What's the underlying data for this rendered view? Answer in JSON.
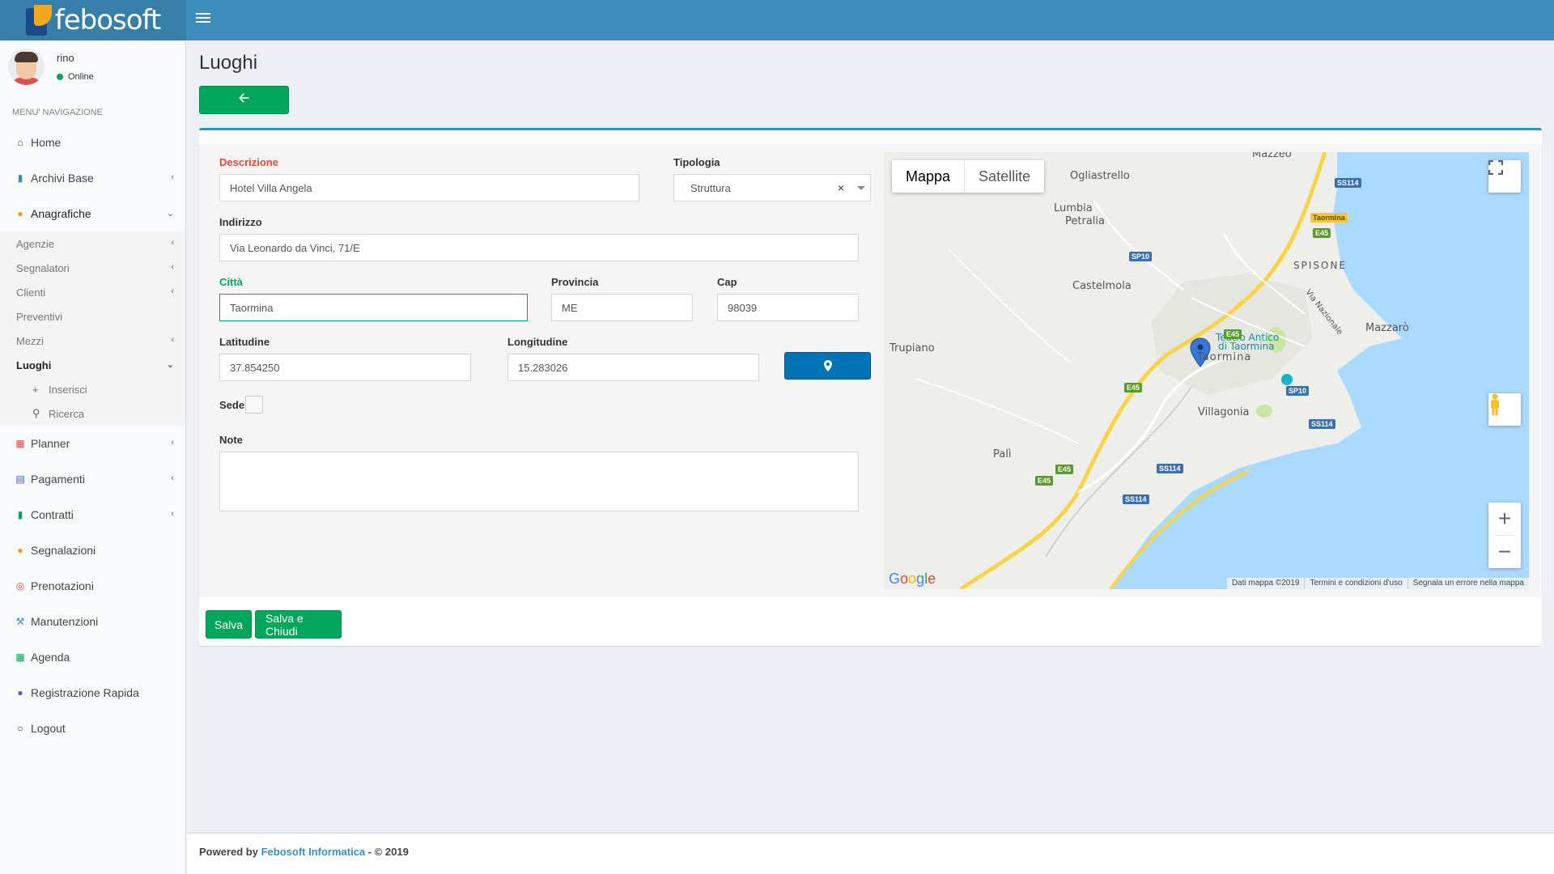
{
  "app": {
    "logo_text": "febosoft"
  },
  "user": {
    "name": "rino",
    "status": "Online"
  },
  "menu": {
    "header": "MENU' NAVIGAZIONE",
    "items": [
      {
        "label": "Home",
        "icon": "home-icon"
      },
      {
        "label": "Archivi Base",
        "icon": "book-icon"
      },
      {
        "label": "Anagrafiche",
        "icon": "user-icon"
      },
      {
        "label": "Planner",
        "icon": "calendar-icon"
      },
      {
        "label": "Pagamenti",
        "icon": "credit-card-icon"
      },
      {
        "label": "Contratti",
        "icon": "file-icon"
      },
      {
        "label": "Segnalazioni",
        "icon": "user-icon"
      },
      {
        "label": "Prenotazioni",
        "icon": "life-ring-icon"
      },
      {
        "label": "Manutenzioni",
        "icon": "wrench-icon"
      },
      {
        "label": "Agenda",
        "icon": "calendar-icon"
      },
      {
        "label": "Registrazione Rapida",
        "icon": "users-icon"
      },
      {
        "label": "Logout",
        "icon": "circle-icon"
      }
    ],
    "anagrafiche_sub": [
      "Agenzie",
      "Segnalatori",
      "Clienti",
      "Preventivi",
      "Mezzi",
      "Luoghi"
    ],
    "luoghi_sub": [
      "Inserisci",
      "Ricerca"
    ]
  },
  "page": {
    "title": "Luoghi"
  },
  "form": {
    "descrizione_label": "Descrizione",
    "descrizione_value": "Hotel Villa Angela",
    "tipologia_label": "Tipologia",
    "tipologia_value": "Struttura",
    "tipologia_clear": "×",
    "indirizzo_label": "Indirizzo",
    "indirizzo_value": "Via Leonardo da Vinci, 71/E",
    "citta_label": "Città",
    "citta_value": "Taormina",
    "provincia_label": "Provincia",
    "provincia_value": "ME",
    "cap_label": "Cap",
    "cap_value": "98039",
    "latitudine_label": "Latitudine",
    "latitudine_value": "37.854250",
    "longitudine_label": "Longitudine",
    "longitudine_value": "15.283026",
    "sede_label": "Sede",
    "note_label": "Note",
    "save_label": "Salva",
    "save_close_label": "Salva e Chiudi"
  },
  "map": {
    "type_map": "Mappa",
    "type_satellite": "Satellite",
    "places": [
      "Mazzeo",
      "Ogliastrello",
      "Lumbia",
      "Petralia",
      "SPISONE",
      "Castelmola",
      "Via Nazionale",
      "Mazzarò",
      "Teatro Antico",
      "di Taormina",
      "Taormina",
      "Trupiano",
      "Villagonia",
      "Palì"
    ],
    "roads": [
      "SS114",
      "E45",
      "SP10",
      "Taormina"
    ],
    "footer": [
      "Dati mappa ©2019",
      "Termini e condizioni d'uso",
      "Segnala un errore nella mappa"
    ],
    "google": "Google",
    "water_color": "#aadaff",
    "land_color": "#eeefea"
  },
  "footer": {
    "powered": "Powered by",
    "company": "Febosoft Informatica",
    "copyright": "- © 2019"
  },
  "colors": {
    "header": "#3c8dbc",
    "logo_bg": "#367fa9",
    "success": "#00a65a",
    "primary": "#0073b7",
    "danger": "#dd4b39"
  }
}
